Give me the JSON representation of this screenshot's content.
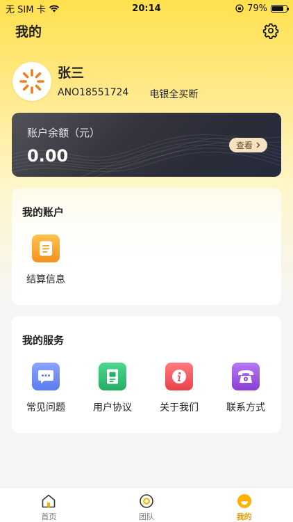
{
  "status_bar": {
    "carrier": "无 SIM 卡",
    "time": "20:14",
    "battery": "79%",
    "battery_level": 0.79
  },
  "header": {
    "title": "我的"
  },
  "profile": {
    "name": "张三",
    "user_id": "ANO18551724",
    "tag": "电银全买断"
  },
  "balance": {
    "label": "账户余额（元）",
    "value": "0.00",
    "view_label": "查看"
  },
  "account": {
    "title": "我的账户",
    "items": [
      {
        "label": "结算信息",
        "icon": "document-icon",
        "color": "#f5a623"
      }
    ]
  },
  "services": {
    "title": "我的服务",
    "items": [
      {
        "label": "常见问题",
        "icon": "chat-icon",
        "color": "#6f8df5"
      },
      {
        "label": "用户协议",
        "icon": "agreement-icon",
        "color": "#33c37a"
      },
      {
        "label": "关于我们",
        "icon": "info-icon",
        "color": "#f0545b"
      },
      {
        "label": "联系方式",
        "icon": "phone-icon",
        "color": "#9a52e0"
      }
    ]
  },
  "tabbar": {
    "items": [
      {
        "label": "首页",
        "icon": "home-icon"
      },
      {
        "label": "团队",
        "icon": "team-icon"
      },
      {
        "label": "我的",
        "icon": "profile-icon",
        "active": true
      }
    ]
  },
  "colors": {
    "accent": "#ffd92e",
    "active_tab": "#e89a00"
  }
}
